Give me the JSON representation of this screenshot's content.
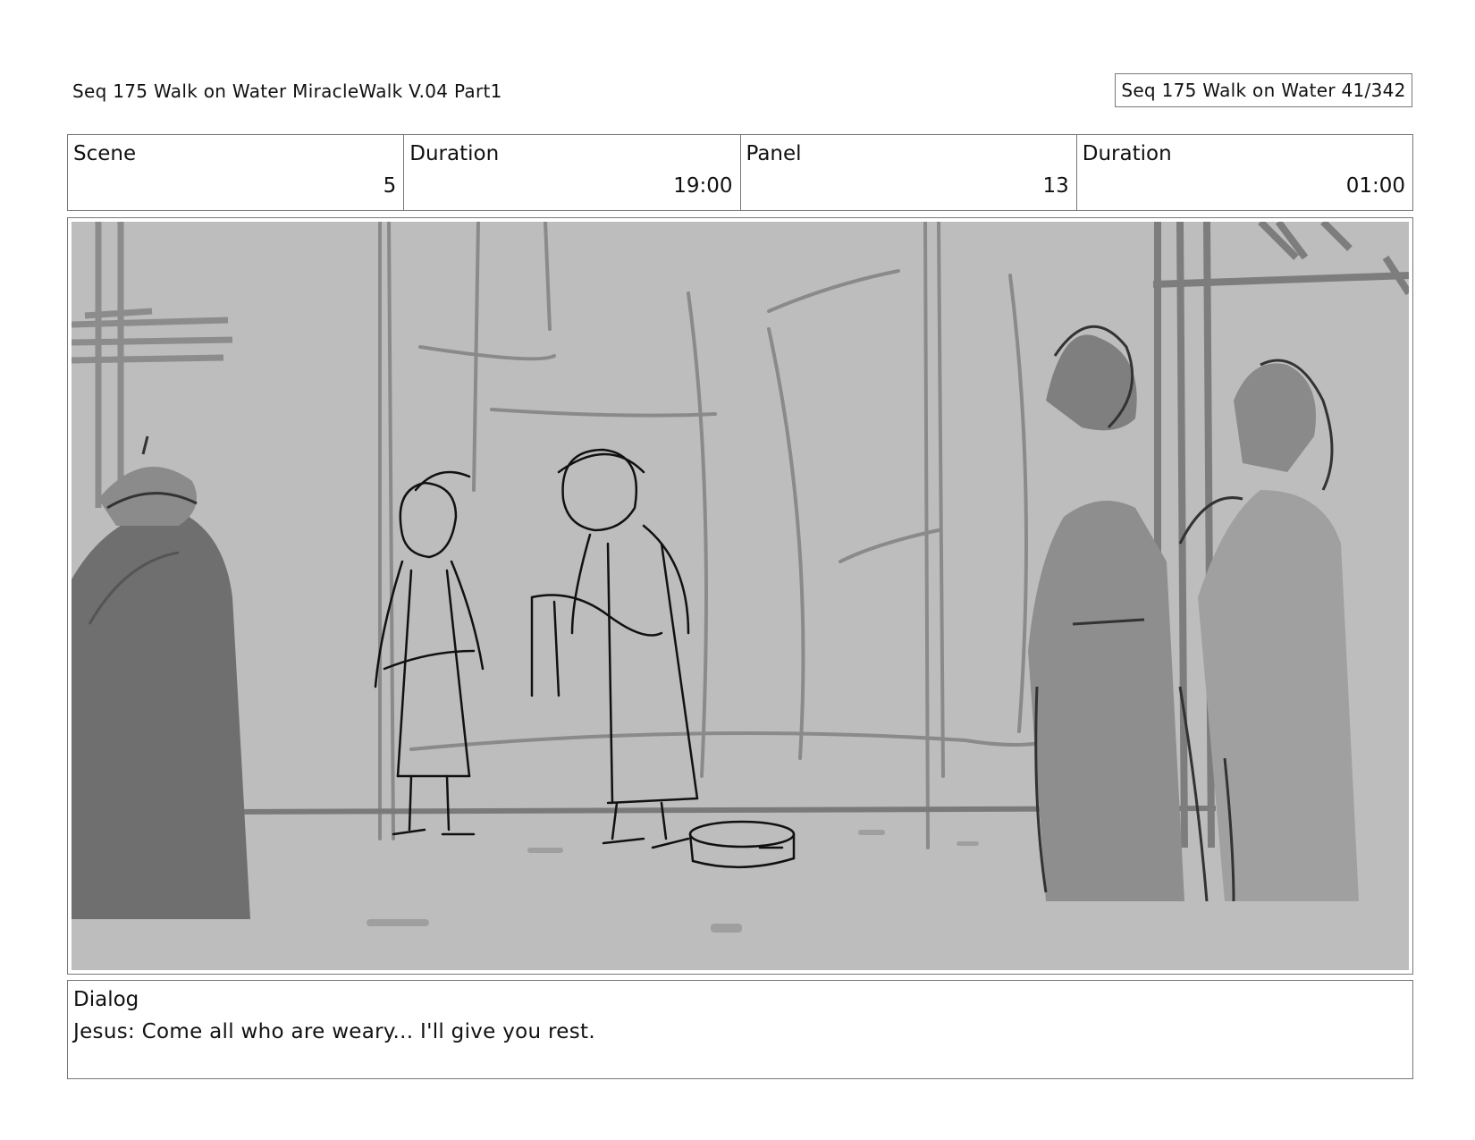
{
  "header": {
    "title": "Seq 175 Walk on Water  MiracleWalk V.04 Part1",
    "page_ref": "Seq 175 Walk on Water  41/342"
  },
  "info": {
    "scene_label": "Scene",
    "scene_value": "5",
    "duration_label": "Duration",
    "duration_value": "19:00",
    "panel_label": "Panel",
    "panel_value": "13",
    "panel_duration_label": "Duration",
    "panel_duration_value": "01:00"
  },
  "panel": {
    "image_subject": "storyboard-sketch"
  },
  "dialog": {
    "label": "Dialog",
    "text": "Jesus: Come all who are weary... I'll give you rest."
  },
  "colors": {
    "background": "#bdbdbd",
    "mid_gray": "#9a9a9a",
    "dark_gray": "#6e6e6e",
    "line": "#111111"
  }
}
